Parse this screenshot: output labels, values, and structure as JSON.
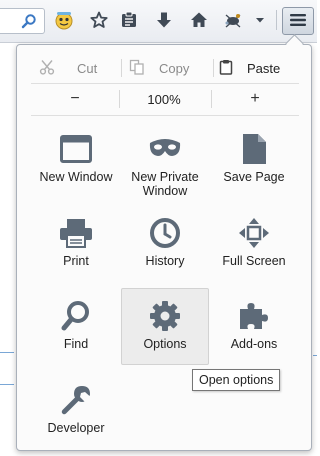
{
  "colors": {
    "icon": "#5d6a78",
    "panel_bg": "#fbfbfb",
    "hover_bg": "#ececec",
    "disabled_text": "#8a8a8a"
  },
  "toolbar": {
    "icons": [
      "search-icon",
      "sync-avatar-icon",
      "bookmark-star-icon",
      "reading-list-icon",
      "downloads-icon",
      "home-icon",
      "addon-icon",
      "dropdown-arrow-icon",
      "menu-icon"
    ]
  },
  "menu": {
    "edit": {
      "cut": "Cut",
      "copy": "Copy",
      "paste": "Paste"
    },
    "zoom": {
      "minus": "−",
      "level": "100%",
      "plus": "+"
    },
    "items": {
      "new_window": "New Window",
      "new_private_window": "New Private Window",
      "save_page": "Save Page",
      "print": "Print",
      "history": "History",
      "full_screen": "Full Screen",
      "find": "Find",
      "options": "Options",
      "addons": "Add-ons",
      "developer": "Developer"
    }
  },
  "tooltip": {
    "text": "Open options"
  }
}
